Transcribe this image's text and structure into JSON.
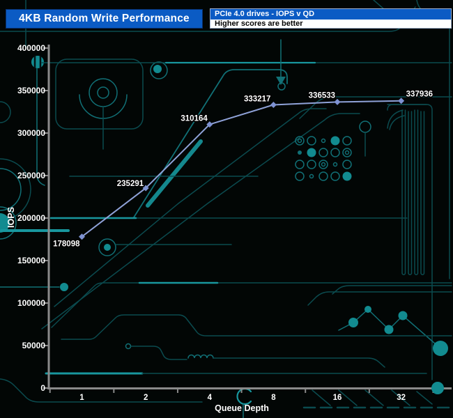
{
  "header": {
    "title": "4KB Random Write Performance",
    "subtitle": "PCIe 4.0 drives - IOPS v QD",
    "note": "Higher scores are better"
  },
  "chart_data": {
    "type": "line",
    "title": "4KB Random Write Performance",
    "subtitle": "PCIe 4.0 drives - IOPS v QD",
    "note": "Higher scores are better",
    "categories": [
      "1",
      "2",
      "4",
      "8",
      "16",
      "32"
    ],
    "series": [
      {
        "name": "PCIe 4.0 drive",
        "values": [
          178098,
          235291,
          310164,
          333217,
          336533,
          337936
        ]
      }
    ],
    "data_labels": [
      "178098",
      "235291",
      "310164",
      "333217",
      "336533",
      "337936"
    ],
    "xlabel": "Queue Depth",
    "ylabel": "IOPS",
    "ylim": [
      0,
      400000
    ],
    "yticks": [
      0,
      50000,
      100000,
      150000,
      200000,
      250000,
      300000,
      350000,
      400000
    ],
    "grid": false,
    "legend": "none"
  },
  "colors": {
    "header_blue": "#0b5bc4",
    "line": "#8fa2d8",
    "marker": "#7e92d2",
    "axis": "#8a8a8a",
    "circuit_dim": "#0b4b4f",
    "circuit_mid": "#117076",
    "circuit_bright": "#18979e",
    "circuit_fill": "#128b90",
    "background": "#020605"
  }
}
